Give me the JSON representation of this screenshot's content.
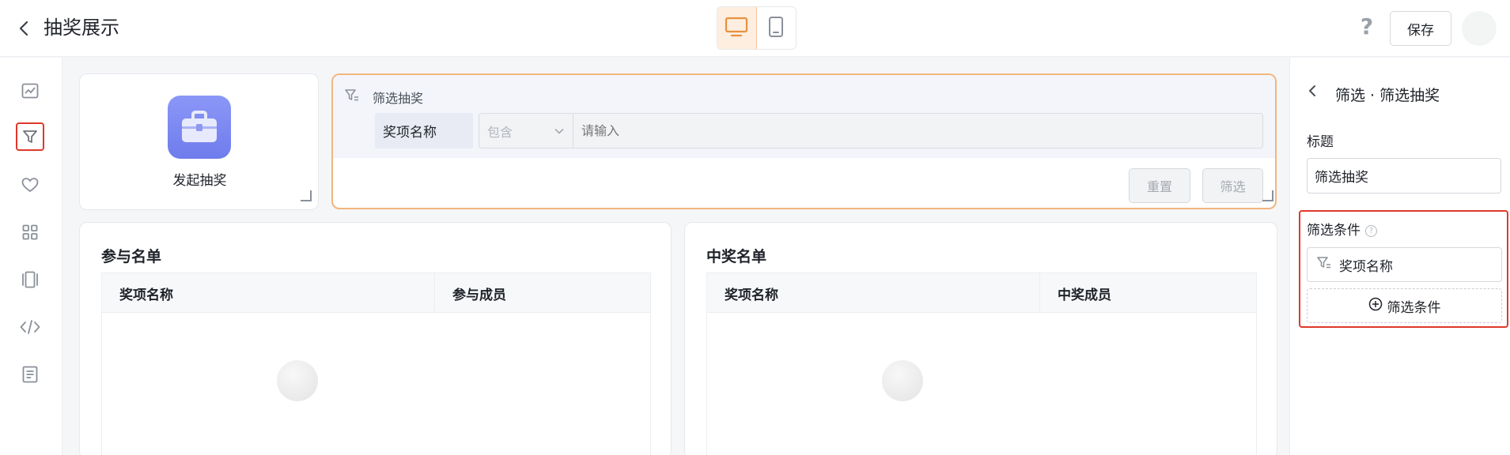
{
  "header": {
    "title": "抽奖展示",
    "help_label": "?",
    "save_label": "保存"
  },
  "rail": {
    "items": [
      "chart-icon",
      "filter-icon",
      "heart-icon",
      "apps-grid-icon",
      "carousel-icon",
      "code-icon",
      "document-icon"
    ],
    "selected": "filter-icon"
  },
  "launch": {
    "label": "发起抽奖"
  },
  "filter_block": {
    "title": "筛选抽奖",
    "field_label": "奖项名称",
    "operator": "包含",
    "input_placeholder": "请输入",
    "reset_label": "重置",
    "filter_label": "筛选"
  },
  "participants": {
    "title": "参与名单",
    "columns": [
      "奖项名称",
      "参与成员"
    ]
  },
  "winners": {
    "title": "中奖名单",
    "columns": [
      "奖项名称",
      "中奖成员"
    ]
  },
  "panel": {
    "title": "筛选 · 筛选抽奖",
    "title_field_label": "标题",
    "title_value": "筛选抽奖",
    "conditions_label": "筛选条件",
    "condition_item": "奖项名称",
    "add_condition_label": "筛选条件"
  },
  "colors": {
    "accent_orange": "#f3b57d",
    "highlight_red": "#e0382a",
    "launch_icon": "#7b87f1"
  }
}
